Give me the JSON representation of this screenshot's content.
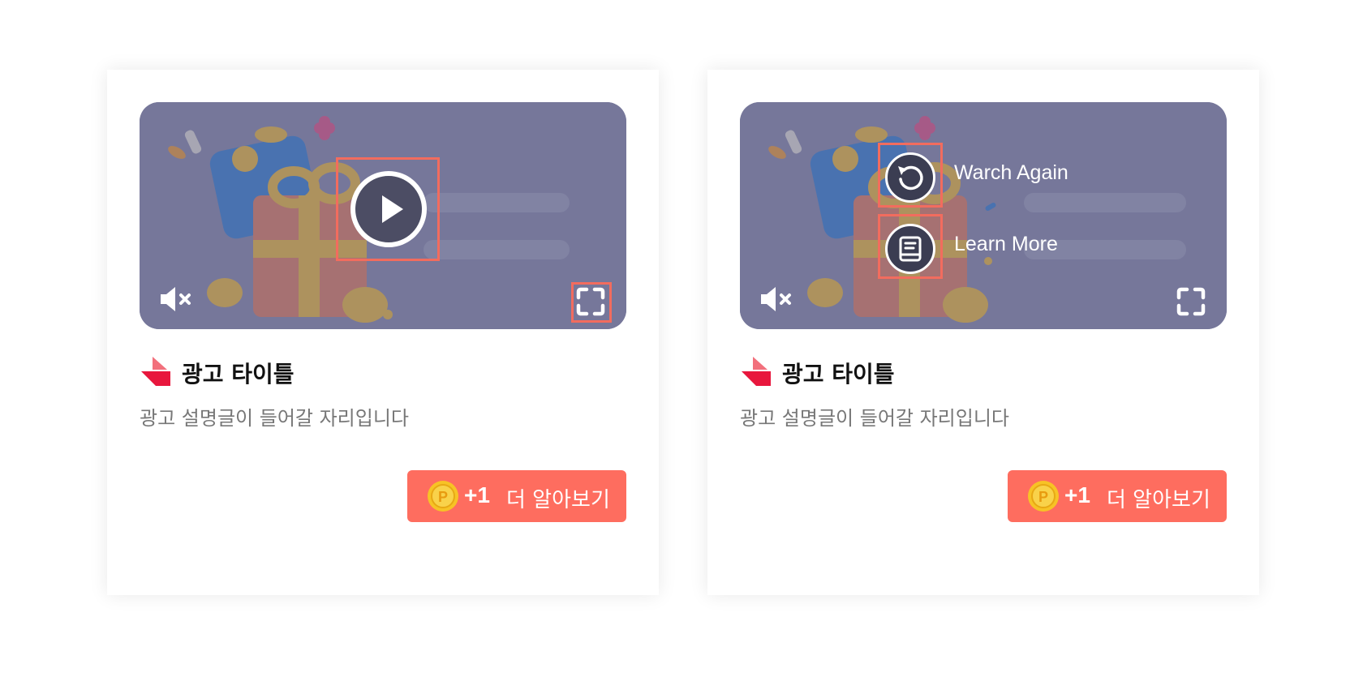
{
  "cards": [
    {
      "title": "광고 타이틀",
      "description": "광고 설명글이 들어갈 자리입니다",
      "cta": {
        "points": "+1",
        "label": "더 알아보기"
      },
      "video_state": "paused",
      "icons": [
        "play-icon",
        "mute-icon",
        "fullscreen-icon",
        "coin-icon",
        "brand-logo"
      ]
    },
    {
      "title": "광고 타이틀",
      "description": "광고 설명글이 들어갈 자리입니다",
      "cta": {
        "points": "+1",
        "label": "더 알아보기"
      },
      "video_state": "ended",
      "overlay_actions": [
        {
          "label": "Warch Again",
          "icon": "replay-icon"
        },
        {
          "label": "Learn More",
          "icon": "book-icon"
        }
      ],
      "icons": [
        "mute-icon",
        "fullscreen-icon",
        "coin-icon",
        "brand-logo"
      ]
    }
  ],
  "colors": {
    "cta_background": "#fe6d5f",
    "highlight_border": "#f26c5e",
    "brand_red": "#e8173d",
    "video_overlay": "#7b7c98",
    "coin": "#f7c325"
  }
}
